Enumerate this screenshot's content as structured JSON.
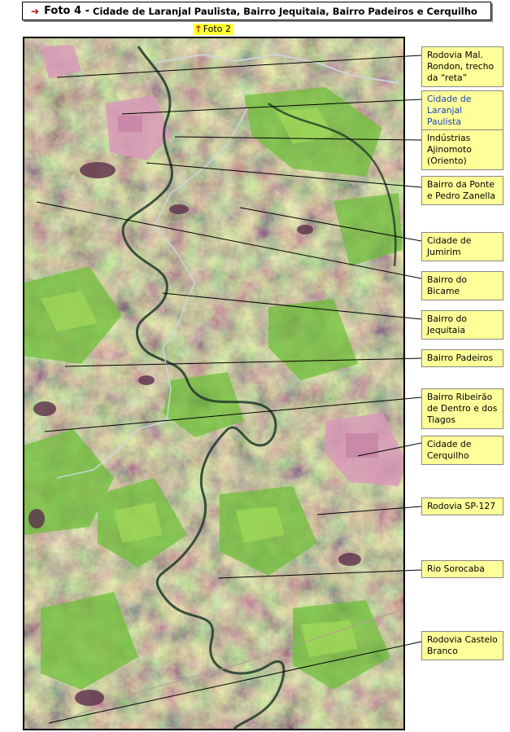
{
  "title": {
    "lead": "Foto 4 -",
    "rest": "Cidade de Laranjal Paulista, Bairro Jequitaia, Bairro Padeiros e Cerquilho"
  },
  "nav": {
    "prev_photo": "Foto 2"
  },
  "colors": {
    "label_bg": "#ffff99",
    "link_bg": "#ffff33",
    "link_text": "#1a3fbf",
    "arrow": "#d00000"
  },
  "icons": [
    "right-arrow-icon",
    "up-arrow-icon"
  ],
  "labels": [
    {
      "id": "rodovia-rondon",
      "text": "Rodovia Mal. Rondon, trecho da “reta”",
      "link": false
    },
    {
      "id": "laranjal",
      "text": "Cidade de Laranjal Paulista",
      "link": true
    },
    {
      "id": "ajinomoto",
      "text": "Indústrias Ajinomoto (Oriento)",
      "link": false
    },
    {
      "id": "ponte",
      "text": "Bairro da Ponte e Pedro Zanella",
      "link": false
    },
    {
      "id": "jumirim",
      "text": "Cidade de Jumirim",
      "link": false
    },
    {
      "id": "bicame",
      "text": "Bairro do Bicame",
      "link": false
    },
    {
      "id": "jequitaia",
      "text": "Bairro do Jequitaia",
      "link": false
    },
    {
      "id": "padeiros",
      "text": "Bairro Padeiros",
      "link": false
    },
    {
      "id": "ribeirao",
      "text": "Bairro Ribeirão de Dentro e dos Tiagos",
      "link": false
    },
    {
      "id": "cerquilho",
      "text": "Cidade de Cerquilho",
      "link": false
    },
    {
      "id": "sp127",
      "text": "Rodovia SP-127",
      "link": false
    },
    {
      "id": "sorocaba",
      "text": "Rio Sorocaba",
      "link": false
    },
    {
      "id": "castelo",
      "text": "Rodovia Castelo Branco",
      "link": false
    }
  ]
}
